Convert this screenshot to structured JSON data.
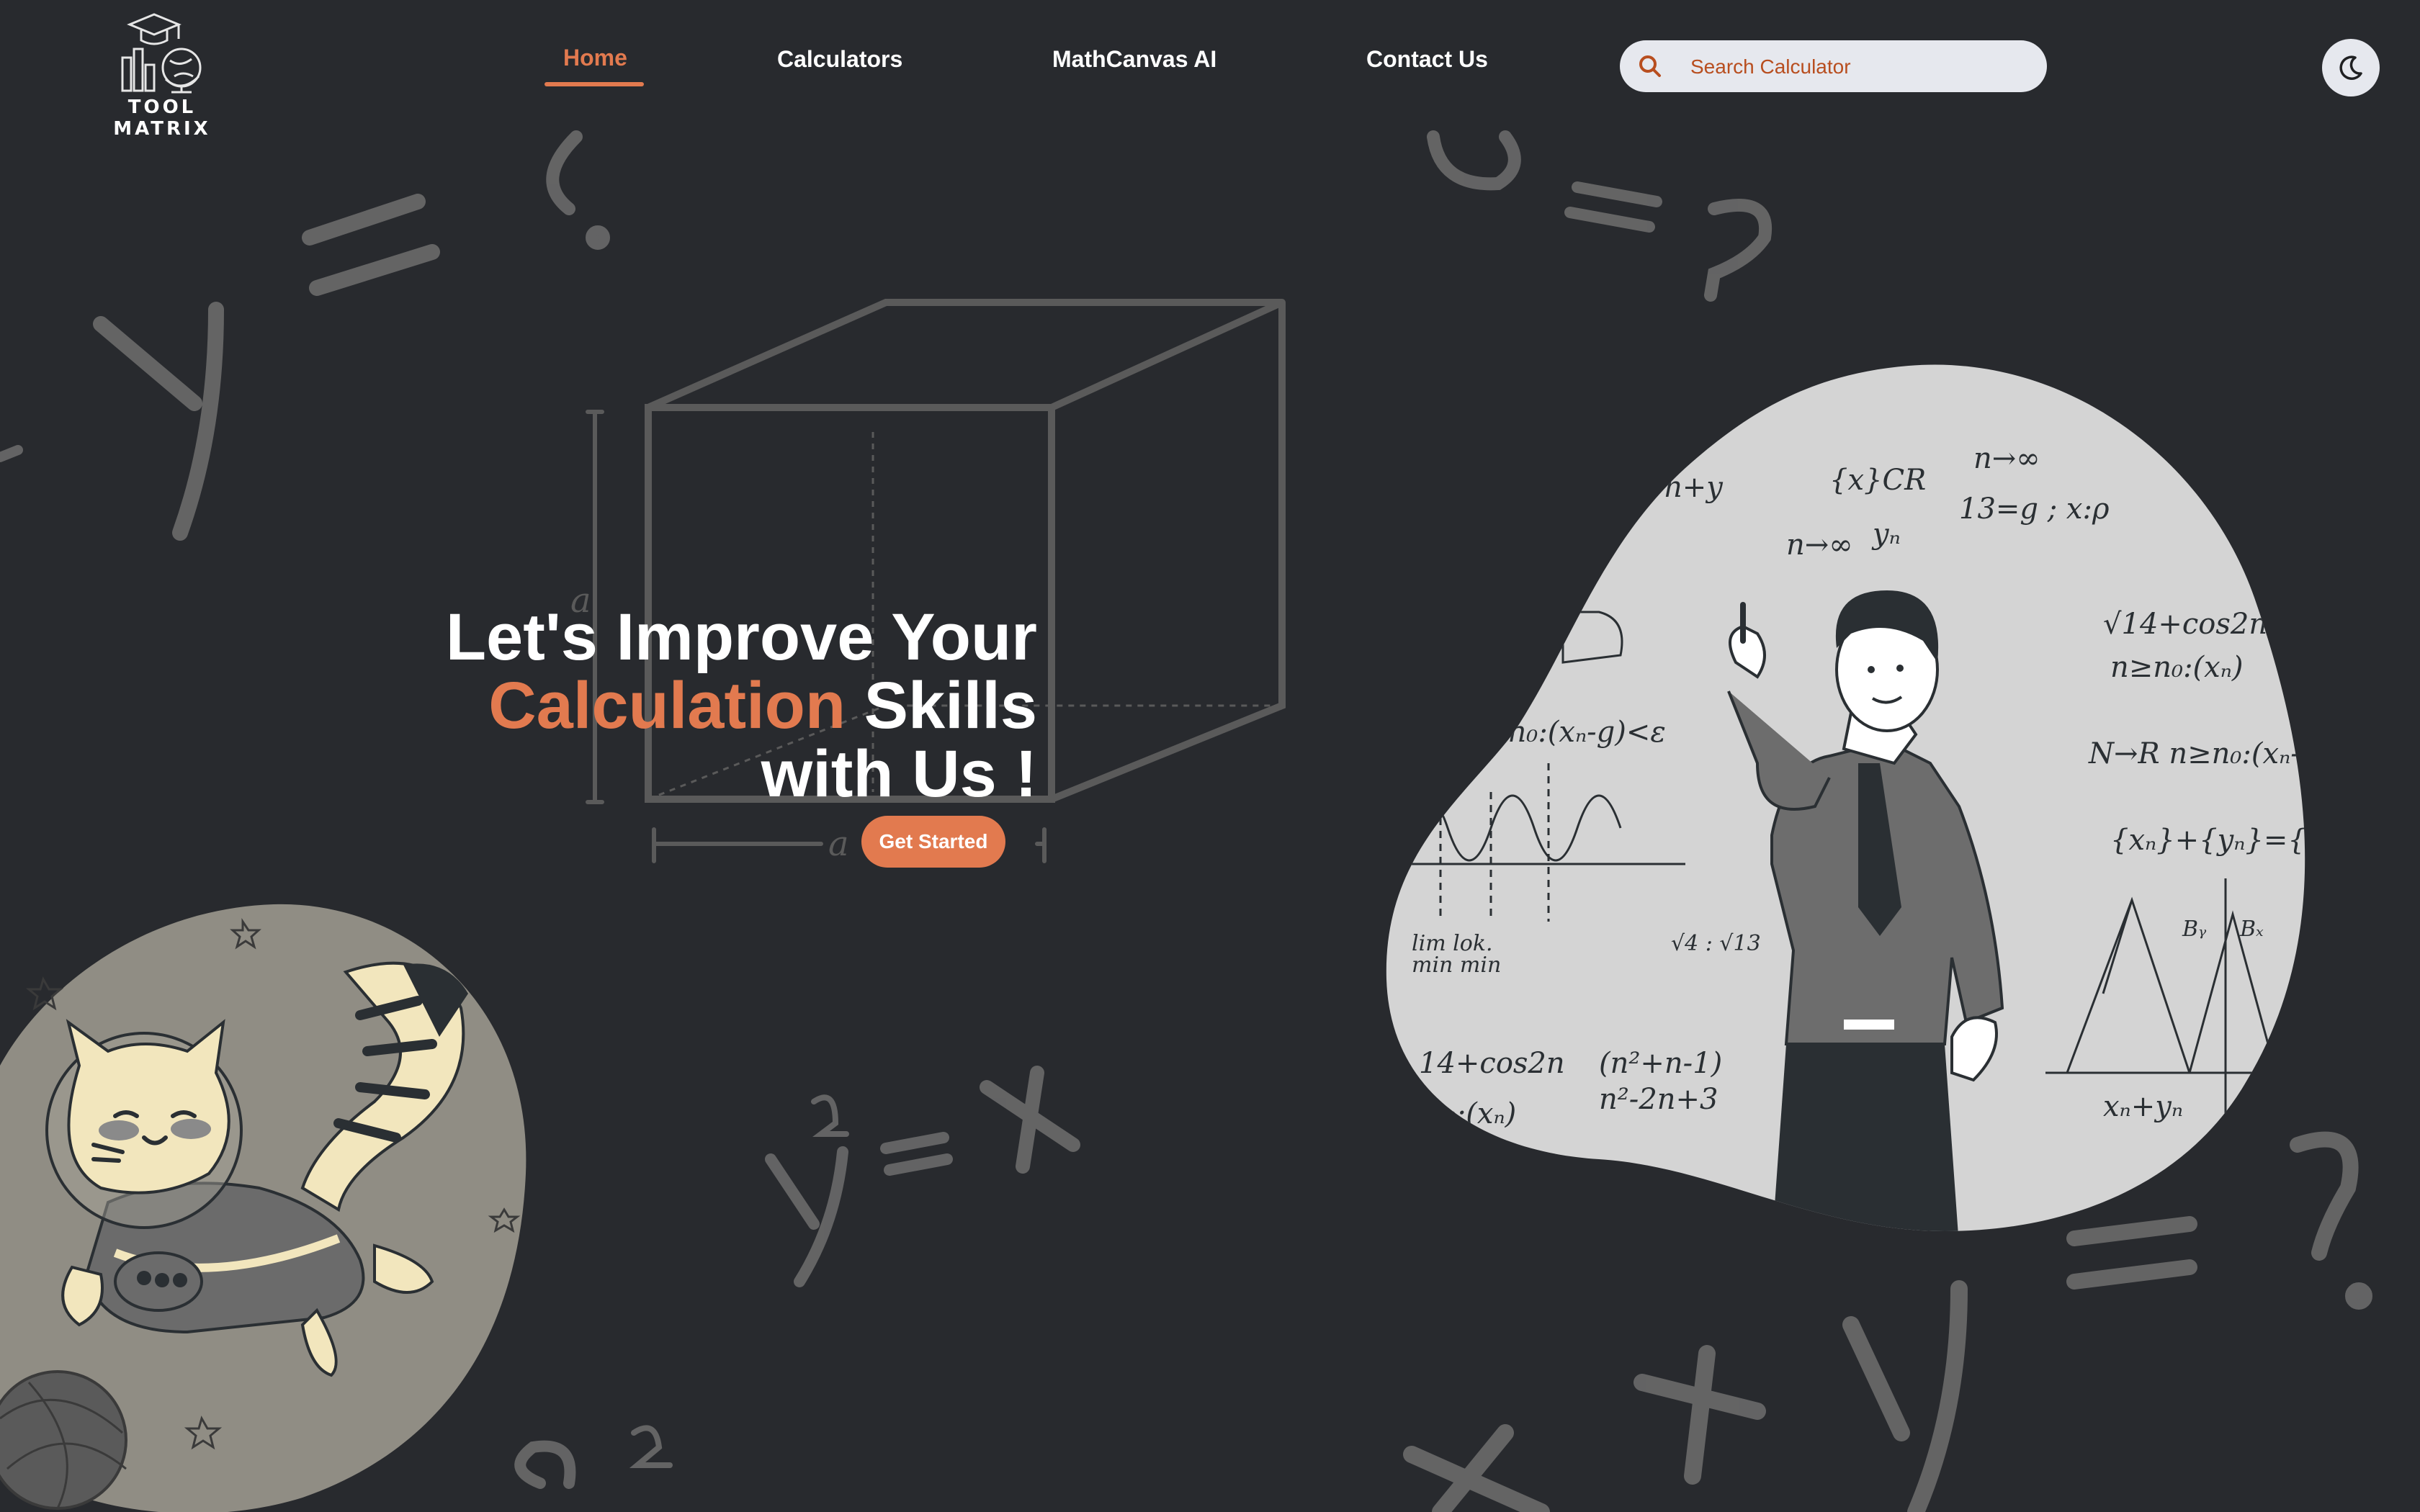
{
  "brand": {
    "name": "TOOL MATRIX"
  },
  "nav": {
    "items": [
      {
        "label": "Home",
        "active": true
      },
      {
        "label": "Calculators",
        "active": false
      },
      {
        "label": "MathCanvas AI",
        "active": false
      },
      {
        "label": "Contact Us",
        "active": false
      }
    ]
  },
  "search": {
    "placeholder": "Search Calculator",
    "icon": "search-icon"
  },
  "theme_toggle": {
    "icon": "moon-icon"
  },
  "hero": {
    "line1": "Let's Improve Your",
    "line2_accent": "Calculation",
    "line2_rest": " Skills",
    "line3": "with Us !",
    "cta_label": "Get Started"
  },
  "colors": {
    "accent": "#e27a4f",
    "background": "#282a2e",
    "search_bg": "#e6e8ee"
  }
}
